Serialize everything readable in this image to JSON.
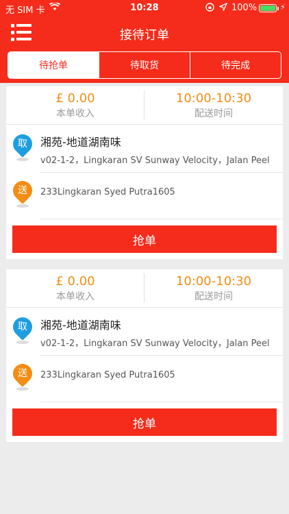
{
  "status": {
    "carrier": "无 SIM 卡",
    "time": "10:28",
    "battery": "100%"
  },
  "nav": {
    "title": "接待订单"
  },
  "tabs": [
    {
      "label": "待抢单",
      "active": true
    },
    {
      "label": "待取货",
      "active": false
    },
    {
      "label": "待完成",
      "active": false
    }
  ],
  "orders": [
    {
      "income": "£ 0.00",
      "income_label": "本单收入",
      "time": "10:00-10:30",
      "time_label": "配送时间",
      "pickup_badge": "取",
      "shop": "湘苑-地道湖南味",
      "shop_address": "v02-1-2，Lingkaran SV Sunway Velocity，Jalan Peel",
      "dropoff_badge": "送",
      "dropoff_address": "233Lingkaran Syed Putra1605",
      "button": "抢单"
    },
    {
      "income": "£ 0.00",
      "income_label": "本单收入",
      "time": "10:00-10:30",
      "time_label": "配送时间",
      "pickup_badge": "取",
      "shop": "湘苑-地道湖南味",
      "shop_address": "v02-1-2，Lingkaran SV Sunway Velocity，Jalan Peel",
      "dropoff_badge": "送",
      "dropoff_address": "233Lingkaran Syed Putra1605",
      "button": "抢单"
    }
  ],
  "colors": {
    "brand": "#f52c1b",
    "accent_orange": "#f38d13",
    "pickup_blue": "#1e9ee0",
    "background": "#ececec"
  }
}
